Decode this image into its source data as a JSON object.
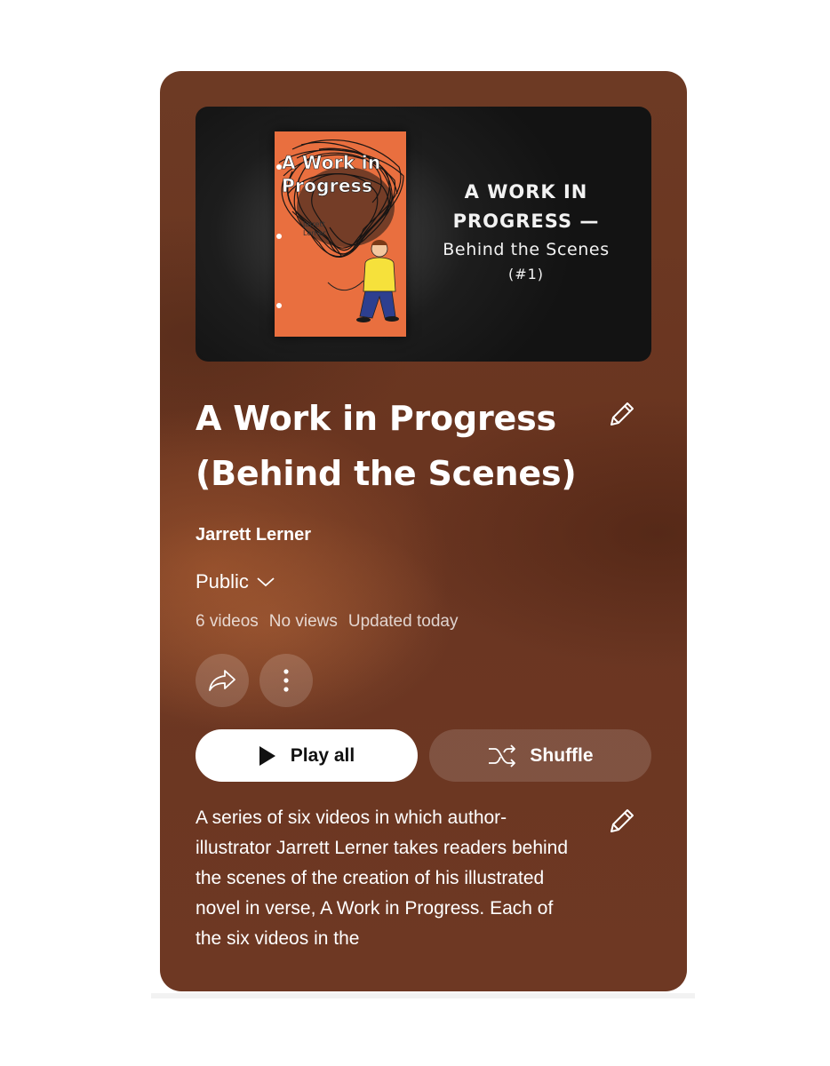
{
  "thumbnail": {
    "book_title_line1": "A Work in",
    "book_title_line2": "Progress",
    "book_author_line1": "Jarrett",
    "book_author_line2": "Lerner",
    "text_line1": "A WORK IN",
    "text_line2": "PROGRESS —",
    "text_line3": "Behind the Scenes",
    "text_line4": "(#1)"
  },
  "playlist": {
    "title_line1": "A Work in Progress",
    "title_line2": "(Behind the Scenes)",
    "owner": "Jarrett Lerner",
    "privacy": "Public",
    "video_count": "6 videos",
    "views": "No views",
    "updated": "Updated today"
  },
  "actions": {
    "play_all_label": "Play all",
    "shuffle_label": "Shuffle"
  },
  "description": "A series of six videos in which author-illustrator Jarrett Lerner takes readers behind the scenes of the creation of his illustrated novel in verse, A Work in Progress. Each of the six videos in the",
  "icons": {
    "edit": "pencil-icon",
    "privacy_dropdown": "chevron-down-icon",
    "share": "share-icon",
    "more": "more-vert-icon",
    "play": "play-icon",
    "shuffle": "shuffle-icon"
  },
  "colors": {
    "card_background": "#6b3622",
    "play_button_background": "#ffffff",
    "text_primary": "#ffffff"
  }
}
